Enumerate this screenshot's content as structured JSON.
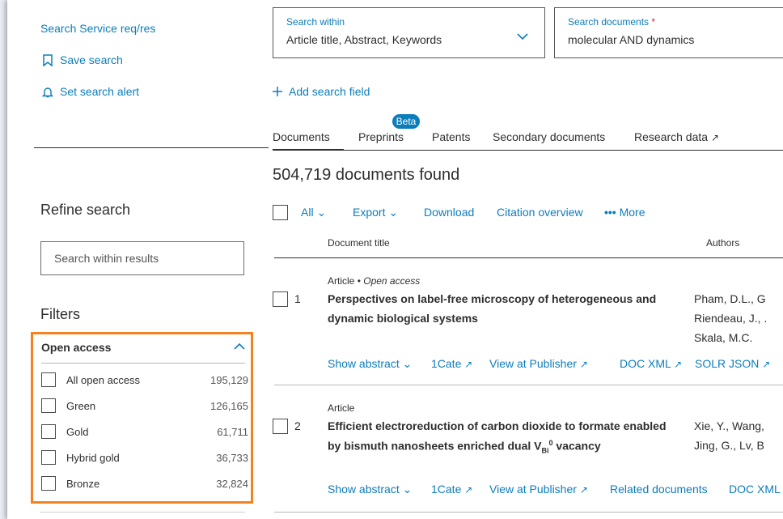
{
  "left": {
    "search_service": "Search Service req/res",
    "save_search": "Save search",
    "set_alert": "Set search alert",
    "refine_title": "Refine search",
    "search_within_placeholder": "Search within results",
    "filters_title": "Filters",
    "open_access": {
      "title": "Open access",
      "items": [
        {
          "label": "All open access",
          "count": "195,129"
        },
        {
          "label": "Green",
          "count": "126,165"
        },
        {
          "label": "Gold",
          "count": "61,711"
        },
        {
          "label": "Hybrid gold",
          "count": "36,733"
        },
        {
          "label": "Bronze",
          "count": "32,824"
        }
      ]
    },
    "highlight_color": "#f58220"
  },
  "search": {
    "within_label": "Search within",
    "within_value": "Article title, Abstract, Keywords",
    "documents_label": "Search documents",
    "documents_required": "*",
    "documents_value": "molecular AND dynamics",
    "add_field": "Add search field"
  },
  "tabs": {
    "documents": "Documents",
    "preprints": "Preprints",
    "beta": "Beta",
    "patents": "Patents",
    "secondary": "Secondary documents",
    "research_data": "Research data"
  },
  "results": {
    "count_text": "504,719 documents found",
    "toolbar": {
      "all": "All",
      "export": "Export",
      "download": "Download",
      "citation": "Citation overview",
      "more": "More"
    },
    "columns": {
      "title": "Document title",
      "authors": "Authors"
    },
    "rows": [
      {
        "num": "1",
        "type": "Article",
        "access": "Open access",
        "title_line1": "Perspectives on label-free microscopy of heterogeneous and",
        "title_line2": "dynamic biological systems",
        "authors": [
          "Pham, D.L., G",
          "Riendeau, J., .",
          "Skala, M.C."
        ],
        "actions": {
          "show_abstract": "Show abstract",
          "cate": "1Cate",
          "publisher": "View at Publisher",
          "doc_xml": "DOC XML",
          "solr_json": "SOLR JSON"
        }
      },
      {
        "num": "2",
        "type": "Article",
        "title_line1": "Efficient electroreduction of carbon dioxide to formate enabled",
        "title_line2_pre": "by bismuth nanosheets enriched dual V",
        "title_sub": "Bi",
        "title_sup": "0",
        "title_line2_post": " vacancy",
        "authors": [
          "Xie, Y., Wang,",
          "Jing, G., Lv, B"
        ],
        "actions": {
          "show_abstract": "Show abstract",
          "cate": "1Cate",
          "publisher": "View at Publisher",
          "related": "Related documents",
          "doc_xml": "DOC XML"
        }
      }
    ]
  },
  "colors": {
    "link": "#0c7dbb",
    "text": "#2e2e2e",
    "required": "#e0202a"
  }
}
